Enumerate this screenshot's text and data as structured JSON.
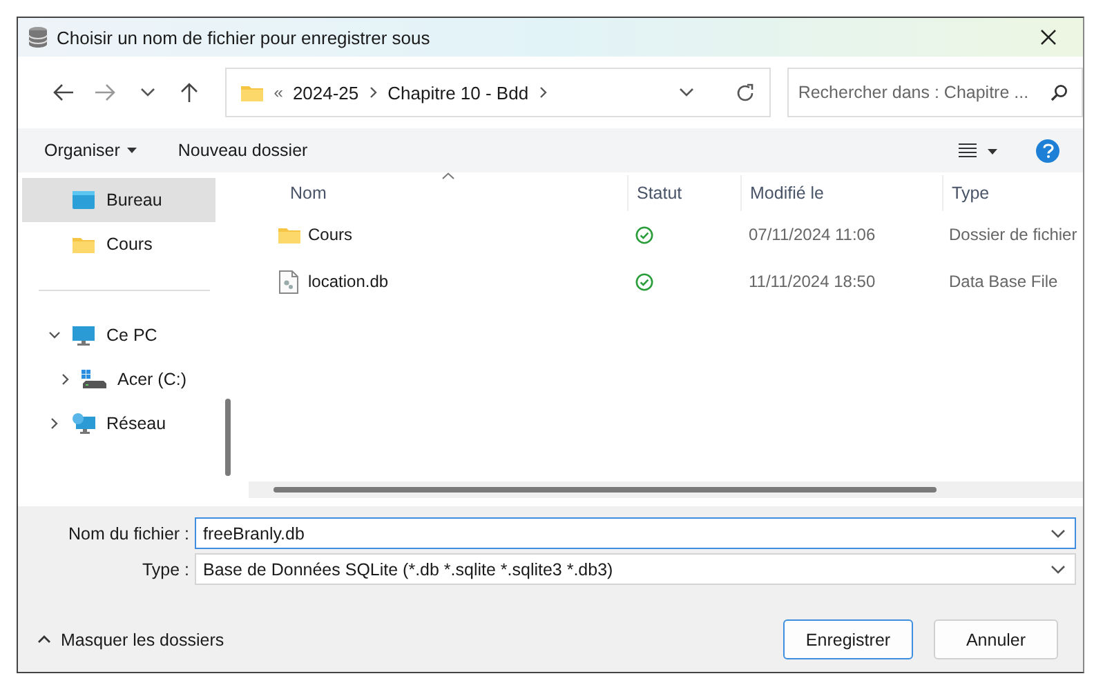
{
  "window": {
    "title": "Choisir un nom de fichier pour enregistrer sous"
  },
  "address_bar": {
    "overflow": "«",
    "crumbs": [
      "2024-25",
      "Chapitre 10 - Bdd"
    ]
  },
  "search": {
    "placeholder": "Rechercher dans : Chapitre ..."
  },
  "toolbar": {
    "organize": "Organiser",
    "new_folder": "Nouveau dossier"
  },
  "sidebar": {
    "groups": [
      [
        {
          "label": "Bureau",
          "kind": "desktop",
          "selected": true
        },
        {
          "label": "Cours",
          "kind": "folder",
          "selected": false
        }
      ],
      [
        {
          "label": "Ce PC",
          "kind": "pc",
          "selected": false,
          "expanded": true,
          "children": [
            {
              "label": "Acer (C:)",
              "kind": "drive",
              "selected": false,
              "expanded": false
            }
          ]
        },
        {
          "label": "Réseau",
          "kind": "network",
          "selected": false,
          "expanded": false
        }
      ]
    ]
  },
  "table": {
    "columns": [
      {
        "label": "Nom",
        "sorted": true
      },
      {
        "label": "Statut",
        "sorted": false
      },
      {
        "label": "Modifié le",
        "sorted": false
      },
      {
        "label": "Type",
        "sorted": false
      }
    ],
    "rows": [
      {
        "name": "Cours",
        "kind": "folder",
        "modified": "07/11/2024 11:06",
        "type": "Dossier de fichier"
      },
      {
        "name": "location.db",
        "kind": "file",
        "modified": "11/11/2024 18:50",
        "type": "Data Base File"
      }
    ]
  },
  "file_name": {
    "label": "Nom du fichier :",
    "value": "freeBranly.db"
  },
  "file_type": {
    "label": "Type :",
    "value": "Base de Données SQLite (*.db *.sqlite *.sqlite3 *.db3)"
  },
  "hide_folders": "Masquer les dossiers",
  "buttons": [
    {
      "label": "Enregistrer",
      "default": true
    },
    {
      "label": "Annuler",
      "default": false
    }
  ]
}
